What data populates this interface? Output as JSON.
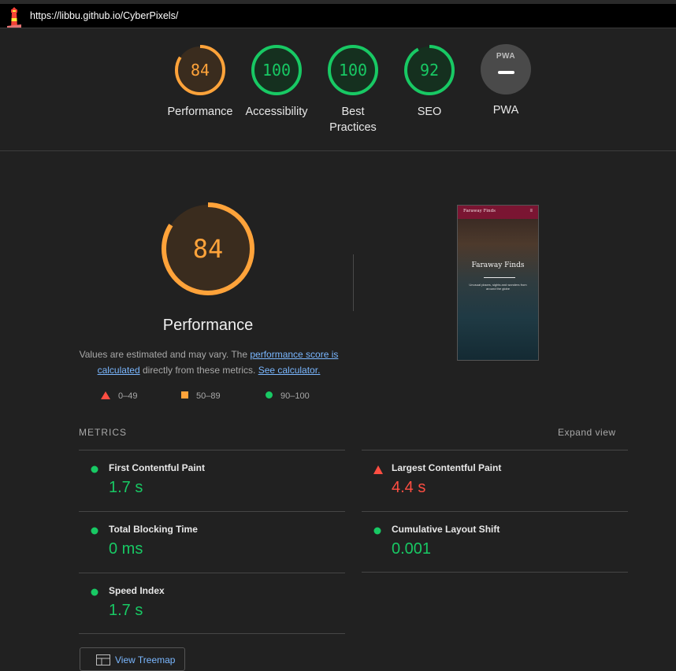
{
  "header": {
    "url": "https://libbu.github.io/CyberPixels/"
  },
  "gauges": [
    {
      "score": "84",
      "label": "Performance",
      "level": 0.84,
      "color": "#ffa33a"
    },
    {
      "score": "100",
      "label": "Accessibility",
      "level": 1.0,
      "color": "#18c964"
    },
    {
      "score": "100",
      "label": "Best Practices",
      "level": 1.0,
      "color": "#18c964"
    },
    {
      "score": "92",
      "label": "SEO",
      "level": 0.92,
      "color": "#18c964"
    },
    {
      "score": "",
      "label": "PWA",
      "badge": "PWA"
    }
  ],
  "performance": {
    "score": "84",
    "level": 0.84,
    "title": "Performance",
    "desc_pre": "Values are estimated and may vary. The ",
    "desc_link1": "performance score is calculated",
    "desc_mid": " directly from these metrics. ",
    "desc_link2": "See calculator."
  },
  "legend": [
    {
      "range": "0–49",
      "icon": "red-triangle-icon"
    },
    {
      "range": "50–89",
      "icon": "orange-square-icon"
    },
    {
      "range": "90–100",
      "icon": "green-circle-icon"
    }
  ],
  "screenshot": {
    "brand": "Faraway Finds",
    "hero": "Faraway Finds",
    "subtitle": "Unusual places, sights and wonders from around the globe"
  },
  "metrics": {
    "header": "METRICS",
    "expand": "Expand view",
    "items": [
      {
        "label": "First Contentful Paint",
        "value": "1.7 s",
        "status": "good"
      },
      {
        "label": "Largest Contentful Paint",
        "value": "4.4 s",
        "status": "poor"
      },
      {
        "label": "Total Blocking Time",
        "value": "0 ms",
        "status": "good"
      },
      {
        "label": "Cumulative Layout Shift",
        "value": "0.001",
        "status": "good"
      },
      {
        "label": "Speed Index",
        "value": "1.7 s",
        "status": "good"
      }
    ]
  },
  "treemap": {
    "label": "View Treemap"
  },
  "colors": {
    "orange": "#ffa33a",
    "green": "#18c964",
    "red": "#ff4e42",
    "link": "#7ab7ff"
  }
}
